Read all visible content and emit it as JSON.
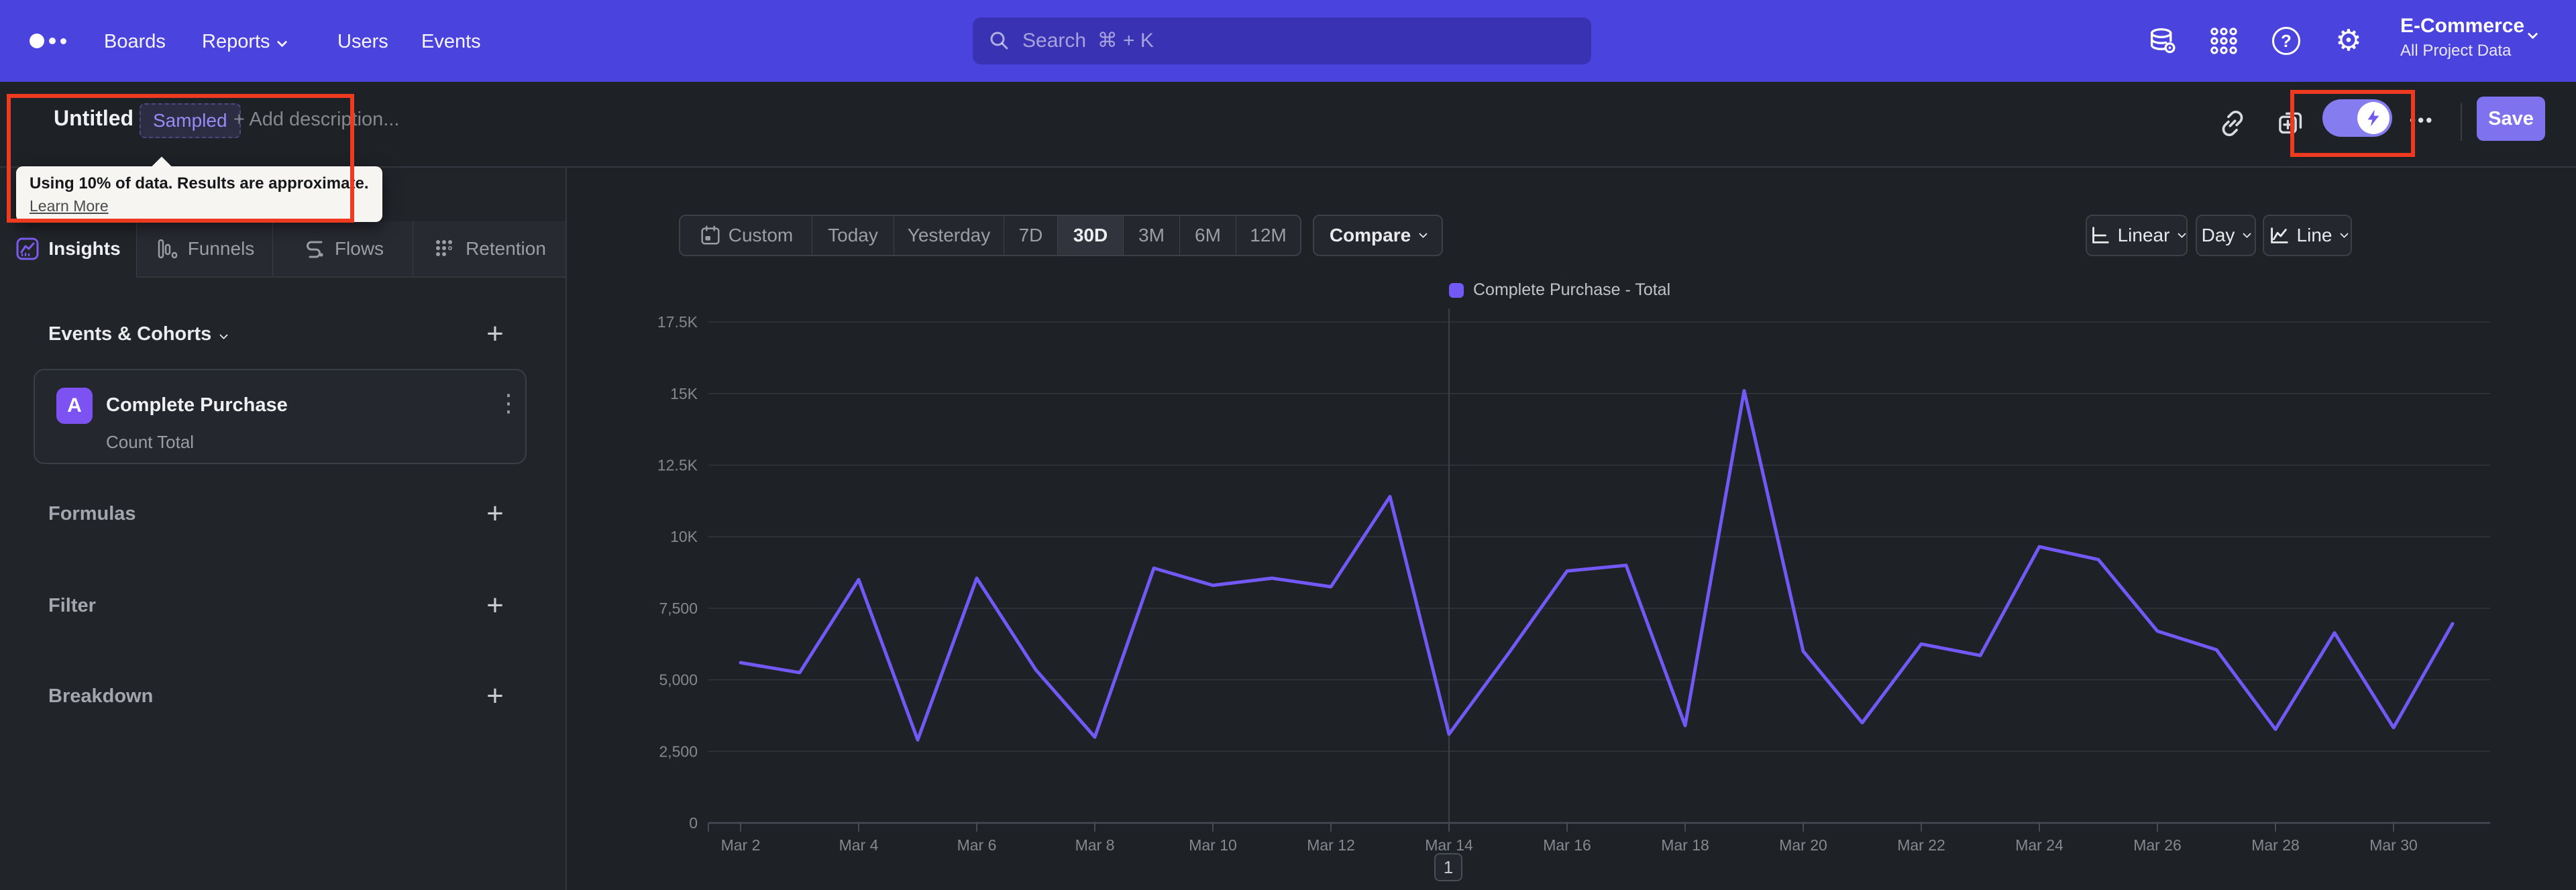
{
  "nav": {
    "items": [
      "Boards",
      "Reports",
      "Users",
      "Events"
    ],
    "search_placeholder": "Search  ⌘ + K",
    "project_name": "E-Commerce",
    "project_scope": "All Project Data"
  },
  "header": {
    "title": "Untitled",
    "badge": "Sampled",
    "add_description": "+ Add description...",
    "tooltip": {
      "line1": "Using 10% of data. Results are approximate.",
      "link": "Learn More"
    },
    "save_label": "Save"
  },
  "icons": {
    "more_menu": "•••",
    "kebab_menu": "⋮",
    "plus": "+",
    "help": "?",
    "gear": "⚙"
  },
  "sidebar": {
    "tabs": [
      {
        "label": "Insights",
        "active": true
      },
      {
        "label": "Funnels",
        "active": false
      },
      {
        "label": "Flows",
        "active": false
      },
      {
        "label": "Retention",
        "active": false
      }
    ],
    "events_header": "Events & Cohorts",
    "event_card": {
      "letter": "A",
      "name": "Complete Purchase",
      "metric": "Count Total"
    },
    "sections": [
      "Formulas",
      "Filter",
      "Breakdown"
    ]
  },
  "toolbar": {
    "ranges": [
      "Custom",
      "Today",
      "Yesterday",
      "7D",
      "30D",
      "3M",
      "6M",
      "12M"
    ],
    "active_range": "30D",
    "compare_label": "Compare",
    "scale_label": "Linear",
    "interval_label": "Day",
    "chart_type_label": "Line"
  },
  "pagination": {
    "page": "1"
  },
  "colors": {
    "nav_bg": "#4b43de",
    "accent": "#7e72ee",
    "line": "#7258f5",
    "annotation_red": "#ee3a21",
    "event_badge": "#7c52f2"
  },
  "chart_data": {
    "type": "line",
    "title": "Complete Purchase - Total",
    "x": [
      "Mar 2",
      "Mar 3",
      "Mar 4",
      "Mar 5",
      "Mar 6",
      "Mar 7",
      "Mar 8",
      "Mar 9",
      "Mar 10",
      "Mar 11",
      "Mar 12",
      "Mar 13",
      "Mar 14",
      "Mar 15",
      "Mar 16",
      "Mar 17",
      "Mar 18",
      "Mar 19",
      "Mar 20",
      "Mar 21",
      "Mar 22",
      "Mar 23",
      "Mar 24",
      "Mar 25",
      "Mar 26",
      "Mar 27",
      "Mar 28",
      "Mar 29",
      "Mar 30",
      "Mar 31"
    ],
    "series": [
      {
        "name": "Complete Purchase - Total",
        "color": "#7258f5",
        "values": [
          5600,
          5250,
          8500,
          2900,
          8550,
          5350,
          3000,
          8900,
          8300,
          8550,
          8250,
          11400,
          3100,
          5900,
          8800,
          9000,
          3400,
          15100,
          6000,
          3500,
          6250,
          5850,
          9650,
          9200,
          6700,
          6050,
          3270,
          6640,
          3330,
          6960
        ]
      }
    ],
    "y_ticks": [
      {
        "value": 0,
        "label": "0"
      },
      {
        "value": 2500,
        "label": "2,500"
      },
      {
        "value": 5000,
        "label": "5,000"
      },
      {
        "value": 7500,
        "label": "7,500"
      },
      {
        "value": 10000,
        "label": "10K"
      },
      {
        "value": 12500,
        "label": "12.5K"
      },
      {
        "value": 15000,
        "label": "15K"
      },
      {
        "value": 17500,
        "label": "17.5K"
      }
    ],
    "ylim": [
      0,
      17500
    ],
    "x_label_every": 2,
    "marker_x": "Mar 14",
    "grid": true,
    "legend_position": "top-center"
  }
}
